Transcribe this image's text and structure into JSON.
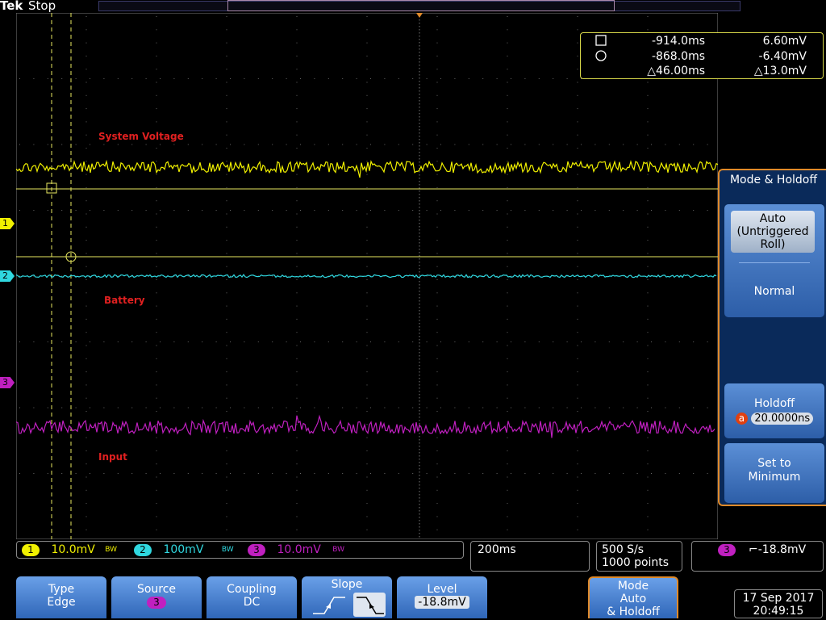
{
  "top_bar": {
    "brand": "Tek",
    "acq_state": "Stop"
  },
  "cursor_readout": {
    "rows": [
      {
        "symbol": "square",
        "time": "-914.0ms",
        "value": "6.60mV"
      },
      {
        "symbol": "circle",
        "time": "-868.0ms",
        "value": "-6.40mV"
      },
      {
        "symbol": "delta",
        "time": "△46.00ms",
        "value": "△13.0mV"
      }
    ]
  },
  "waveform_labels": {
    "system_voltage": "System Voltage",
    "battery": "Battery",
    "input": "Input"
  },
  "channel_markers": {
    "ch1": "1",
    "ch2": "2",
    "ch3": "3"
  },
  "side_menu": {
    "title": "Mode & Holdoff",
    "auto_label": "Auto (Untriggered Roll)",
    "normal_label": "Normal",
    "holdoff_label": "Holdoff",
    "holdoff_value": "20.0000ns",
    "holdoff_knob": "a",
    "set_min_label": "Set to Minimum"
  },
  "status_bar": {
    "ch1": {
      "num": "1",
      "scale": "10.0mV",
      "bw": "BW",
      "color": "#f0f000"
    },
    "ch2": {
      "num": "2",
      "scale": "100mV",
      "bw": "BW",
      "color": "#30d8e0"
    },
    "ch3": {
      "num": "3",
      "scale": "10.0mV",
      "bw": "BW",
      "color": "#c020c0"
    },
    "timebase": "200ms",
    "sample_rate": "500 S/s",
    "record_length": "1000 points",
    "trigger_source": "3",
    "trigger_level": "⌐-18.8mV"
  },
  "bottom_menu": {
    "type_label": "Type",
    "type_value": "Edge",
    "source_label": "Source",
    "source_value": "3",
    "coupling_label": "Coupling",
    "coupling_value": "DC",
    "slope_label": "Slope",
    "level_label": "Level",
    "level_value": "-18.8mV",
    "mode_label": "Mode",
    "mode_value": "Auto",
    "mode_sub": "& Holdoff"
  },
  "datetime": {
    "date": "17 Sep 2017",
    "time": "20:49:15"
  },
  "colors": {
    "ch1": "#f0f000",
    "ch2": "#30d8e0",
    "ch3": "#c020c0",
    "menu_accent": "#e08a2a",
    "label_red": "#e02020"
  }
}
